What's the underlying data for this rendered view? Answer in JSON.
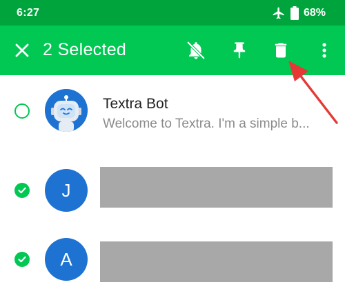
{
  "status_bar": {
    "time": "6:27",
    "battery": "68%",
    "icons": [
      "airplane-mode-icon",
      "battery-icon"
    ]
  },
  "action_bar": {
    "title": "2 Selected",
    "icons": [
      "close-icon",
      "mute-notifications-icon",
      "pin-icon",
      "delete-icon",
      "more-options-icon"
    ]
  },
  "conversations": [
    {
      "name": "Textra Bot",
      "snippet": "Welcome to Textra. I'm a simple b...",
      "selected": false,
      "avatar": "robot-icon"
    },
    {
      "initial": "J",
      "selected": true,
      "content": "redacted"
    },
    {
      "initial": "A",
      "selected": true,
      "content": "redacted"
    }
  ],
  "colors": {
    "status_bar": "#00a43c",
    "action_bar": "#00c853",
    "avatar": "#1e73d2",
    "check": "#00c853",
    "annotation_arrow": "#e53935",
    "redaction": "#a8a8a8"
  }
}
